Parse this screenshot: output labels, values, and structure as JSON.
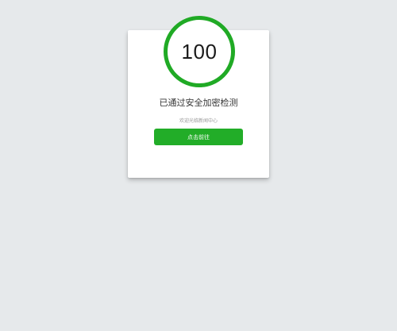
{
  "security_check": {
    "score": "100",
    "title": "已通过安全加密检测",
    "subtitle": "欢迎光临新闻中心",
    "button_label": "点击前往"
  },
  "colors": {
    "background": "#e6e9eb",
    "card": "#ffffff",
    "accent_green": "#22ad28"
  }
}
